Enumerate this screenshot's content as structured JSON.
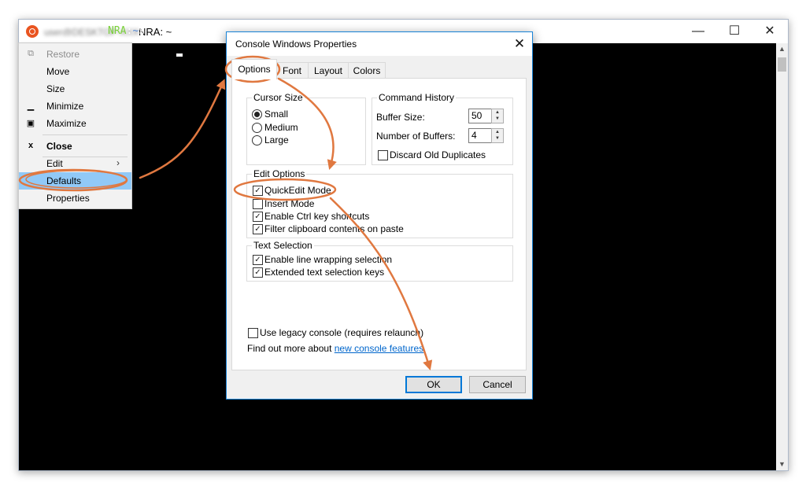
{
  "terminal": {
    "title_obscured": "user@DESKTOP-XXXX",
    "title_visible": "NRA: ~",
    "prompt_host": "NRA",
    "prompt_sep": ":",
    "prompt_dir": "~",
    "prompt_sign": "$",
    "controls": {
      "minimize": "—",
      "maximize": "☐",
      "close": "✕"
    }
  },
  "system_menu": {
    "items": [
      {
        "label": "Restore",
        "icon": "restore-icon",
        "glyph": "⧉",
        "disabled": true
      },
      {
        "label": "Move",
        "icon": "",
        "glyph": ""
      },
      {
        "label": "Size",
        "icon": "",
        "glyph": ""
      },
      {
        "label": "Minimize",
        "icon": "minimize-icon",
        "glyph": "▁"
      },
      {
        "label": "Maximize",
        "icon": "maximize-icon",
        "glyph": "▣"
      },
      {
        "label": "Close",
        "icon": "close-icon",
        "glyph": "x",
        "bold": true
      },
      {
        "label": "Edit",
        "submenu": "›"
      },
      {
        "label": "Defaults",
        "highlighted": true
      },
      {
        "label": "Properties"
      }
    ]
  },
  "dialog": {
    "title": "Console Windows Properties",
    "close": "✕",
    "tabs": [
      "Options",
      "Font",
      "Layout",
      "Colors"
    ],
    "active_tab": "Options",
    "cursor_size": {
      "title": "Cursor Size",
      "options": [
        "Small",
        "Medium",
        "Large"
      ],
      "selected": "Small"
    },
    "command_history": {
      "title": "Command History",
      "buffer_size_label": "Buffer Size:",
      "buffer_size": "50",
      "num_buffers_label": "Number of Buffers:",
      "num_buffers": "4",
      "discard_label": "Discard Old Duplicates",
      "discard_checked": false
    },
    "edit_options": {
      "title": "Edit Options",
      "items": [
        {
          "label": "QuickEdit Mode",
          "checked": true
        },
        {
          "label": "Insert Mode",
          "checked": false
        },
        {
          "label": "Enable Ctrl key shortcuts",
          "checked": true
        },
        {
          "label": "Filter clipboard contents on paste",
          "checked": true
        }
      ]
    },
    "text_selection": {
      "title": "Text Selection",
      "items": [
        {
          "label": "Enable line wrapping selection",
          "checked": true
        },
        {
          "label": "Extended text selection keys",
          "checked": true
        }
      ]
    },
    "legacy_label": "Use legacy console (requires relaunch)",
    "legacy_checked": false,
    "find_out_text": "Find out more about",
    "find_out_link": "new console features",
    "ok": "OK",
    "cancel": "Cancel"
  },
  "colors": {
    "annotation": "#e07840",
    "highlight": "#91c9f7",
    "accent": "#0078d7",
    "terminal_bg": "#000000",
    "prompt_green": "#7ad13a"
  }
}
